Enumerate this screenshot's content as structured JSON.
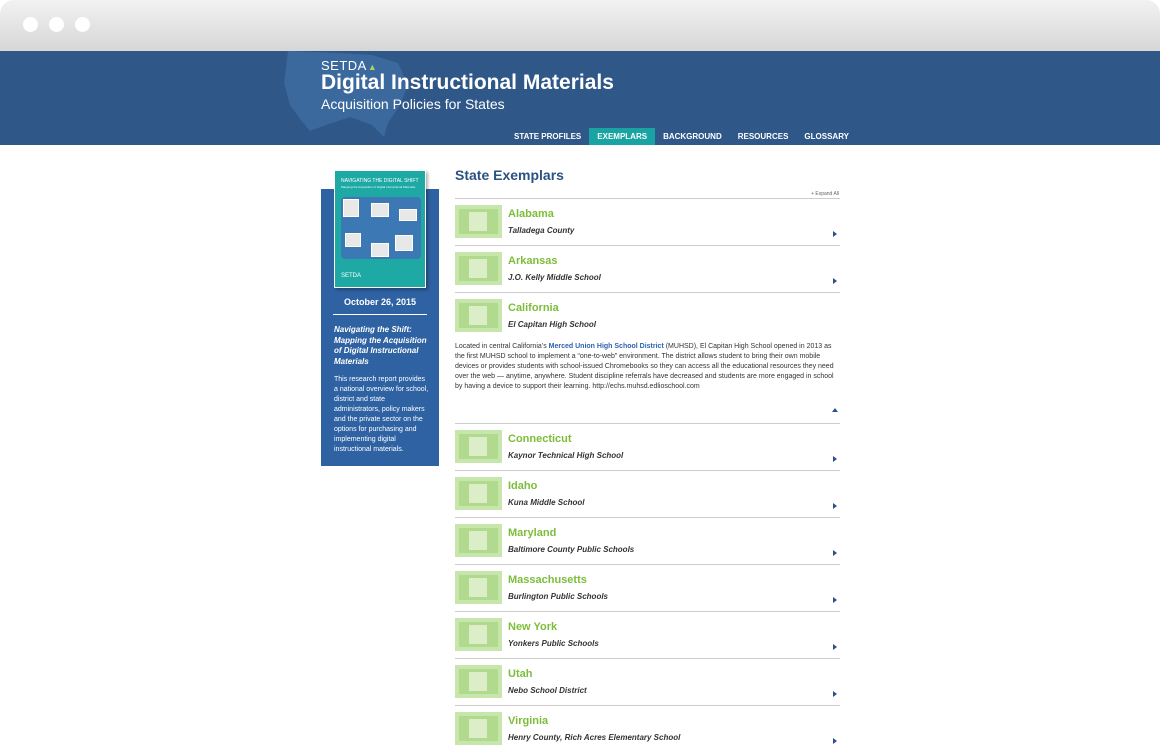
{
  "header": {
    "logo": "SETDA",
    "title": "Digital Instructional Materials",
    "subtitle": "Acquisition Policies for States",
    "nav": [
      "STATE PROFILES",
      "EXEMPLARS",
      "BACKGROUND",
      "RESOURCES",
      "GLOSSARY"
    ],
    "active_nav": "EXEMPLARS"
  },
  "sidebar": {
    "cover_title": "NAVIGATING THE DIGITAL SHIFT",
    "cover_subtitle": "Mapping the Acquisition of Digital Instructional Materials",
    "cover_logo": "SETDA",
    "date": "October 26, 2015",
    "report_title": "Navigating the Shift: Mapping the Acquisition of Digital Instructional Materials",
    "report_desc": "This research report provides a national overview for school, district and state administrators, policy makers and the private sector on the options for purchasing and implementing digital instructional materials."
  },
  "main": {
    "title": "State Exemplars",
    "expand_all": "+ Expand All",
    "rows": [
      {
        "state": "Alabama",
        "school": "Talladega County"
      },
      {
        "state": "Arkansas",
        "school": "J.O. Kelly Middle School"
      },
      {
        "state": "California",
        "school": "El Capitan High School",
        "desc_before": "Located in central California’s ",
        "desc_link": "Merced Union High School District",
        "desc_after": " (MUHSD), El Capitan High School opened in 2013 as the first MUHSD school to implement a “one-to-web” environment. The district allows student to bring their own mobile devices or provides students with school-issued Chromebooks so they can access all the educational resources they need over the web — anytime, anywhere. Student discipline referrals have decreased and students are more engaged in school by having a device to support their learning. http://echs.muhsd.edlioschool.com"
      },
      {
        "state": "Connecticut",
        "school": "Kaynor Technical High School"
      },
      {
        "state": "Idaho",
        "school": "Kuna Middle School"
      },
      {
        "state": "Maryland",
        "school": "Baltimore County Public Schools"
      },
      {
        "state": "Massachusetts",
        "school": "Burlington Public Schools"
      },
      {
        "state": "New York",
        "school": "Yonkers Public Schools"
      },
      {
        "state": "Utah",
        "school": "Nebo School District"
      },
      {
        "state": "Virginia",
        "school": "Henry County, Rich Acres Elementary School"
      }
    ]
  },
  "colors": {
    "header_bg": "#2f5788",
    "nav_active": "#19a3a3",
    "state_green": "#7dbd3a",
    "title_blue": "#2b5283",
    "sidebar_blue": "#2f62a3",
    "thumb_green": "#c7e6ab"
  }
}
